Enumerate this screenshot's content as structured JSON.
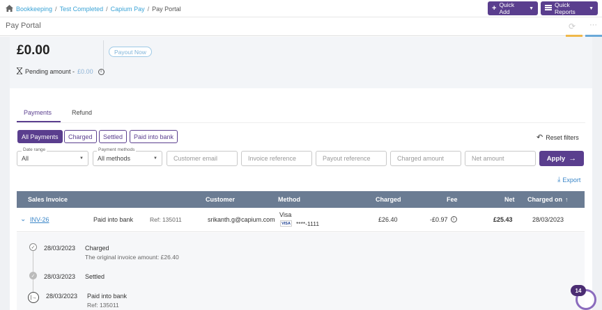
{
  "breadcrumb": {
    "items": [
      "Bookkeeping",
      "Test Completed",
      "Capium Pay"
    ],
    "current": "Pay Portal",
    "sep": "/"
  },
  "header_buttons": {
    "quick_add": "Quick Add",
    "quick_reports": "Quick Reports"
  },
  "page": {
    "title": "Pay Portal"
  },
  "summary": {
    "amount": "£0.00",
    "payout_label": "Payout Now",
    "pending_label": "Pending amount -",
    "pending_value": "£0.00"
  },
  "tabs": [
    {
      "label": "Payments",
      "active": true
    },
    {
      "label": "Refund",
      "active": false
    }
  ],
  "filter_chips": [
    {
      "label": "All Payments",
      "active": true
    },
    {
      "label": "Charged"
    },
    {
      "label": "Settled"
    },
    {
      "label": "Paid into bank"
    }
  ],
  "reset_label": "Reset filters",
  "filters": {
    "date_range": {
      "label": "Date range",
      "value": "All"
    },
    "payment_methods": {
      "label": "Payment methods",
      "value": "All methods"
    },
    "customer_email": "Customer email",
    "invoice_reference": "Invoice reference",
    "payout_reference": "Payout reference",
    "charged_amount": "Charged amount",
    "net_amount": "Net amount",
    "apply_label": "Apply"
  },
  "export_label": "Export",
  "table": {
    "headers": {
      "sales_invoice": "Sales Invoice",
      "customer": "Customer",
      "method": "Method",
      "charged": "Charged",
      "fee": "Fee",
      "net": "Net",
      "charged_on": "Charged on"
    },
    "rows": [
      {
        "invoice": "INV-26",
        "status": "Paid into bank",
        "ref": "Ref: 135011",
        "customer": "srikanth.g@capium.com",
        "method": "Visa",
        "card_brand": "VISA",
        "card_number": "****-1111",
        "charged": "£26.40",
        "fee": "-£0.97",
        "net": "£25.43",
        "charged_on": "28/03/2023"
      }
    ]
  },
  "timeline": [
    {
      "date": "28/03/2023",
      "title": "Charged",
      "sub": "The original invoice amount: £26.40"
    },
    {
      "date": "28/03/2023",
      "title": "Settled",
      "sub": ""
    },
    {
      "date": "28/03/2023",
      "title": "Paid into bank",
      "sub": "Ref: 135011"
    }
  ],
  "notification_count": "14",
  "colors": {
    "brand": "#5a3e8e",
    "table_header": "#6b7c93",
    "link": "#3a86c8"
  }
}
